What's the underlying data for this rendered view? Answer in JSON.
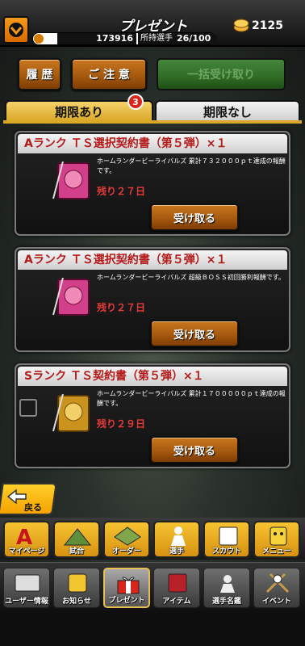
{
  "header": {
    "title": "プレゼント",
    "coins": "2125",
    "players_total": "173916",
    "players_label": "所持選手",
    "players_count": "26/100"
  },
  "actions": {
    "history": "履 歴",
    "caution": "ご 注 意",
    "receive_all": "一括受け取り"
  },
  "tabs": {
    "with_limit": "期限あり",
    "with_limit_badge": "3",
    "no_limit": "期限なし"
  },
  "presents": [
    {
      "title": "Aランク ＴＳ選択契約書（第５弾）×１",
      "desc": "ホームランダービーライバルズ 累計７３２０００ｐｔ達成の報酬です。",
      "days": "残り２７日",
      "button": "受け取る",
      "item_color": "#d23f8b"
    },
    {
      "title": "Aランク ＴＳ選択契約書（第５弾）×１",
      "desc": "ホームランダービーライバルズ 超級ＢＯＳＳ初回勝利報酬です。",
      "days": "残り２７日",
      "button": "受け取る",
      "item_color": "#d23f8b"
    },
    {
      "title": "Sランク ＴＳ契約書（第５弾）×１",
      "desc": "ホームランダービーライバルズ 累計１７０００００ｐｔ達成の報酬です。",
      "days": "残り２９日",
      "button": "受け取る",
      "item_color": "#c9931e"
    }
  ],
  "back": "戻る",
  "nav_main": [
    {
      "label": "マイページ",
      "icon": "a-letter-icon"
    },
    {
      "label": "試合",
      "icon": "stadium-icon"
    },
    {
      "label": "オーダー",
      "icon": "field-icon"
    },
    {
      "label": "選手",
      "icon": "player-icon"
    },
    {
      "label": "スカウト",
      "icon": "scout-icon"
    },
    {
      "label": "メニュー",
      "icon": "menu-icon"
    }
  ],
  "nav_sub": [
    {
      "label": "ユーザー情報",
      "icon": "user-info-icon"
    },
    {
      "label": "お知らせ",
      "icon": "notice-icon"
    },
    {
      "label": "プレゼント",
      "icon": "present-icon"
    },
    {
      "label": "アイテム",
      "icon": "item-icon"
    },
    {
      "label": "選手名鑑",
      "icon": "player-list-icon"
    },
    {
      "label": "イベント",
      "icon": "event-icon"
    }
  ]
}
